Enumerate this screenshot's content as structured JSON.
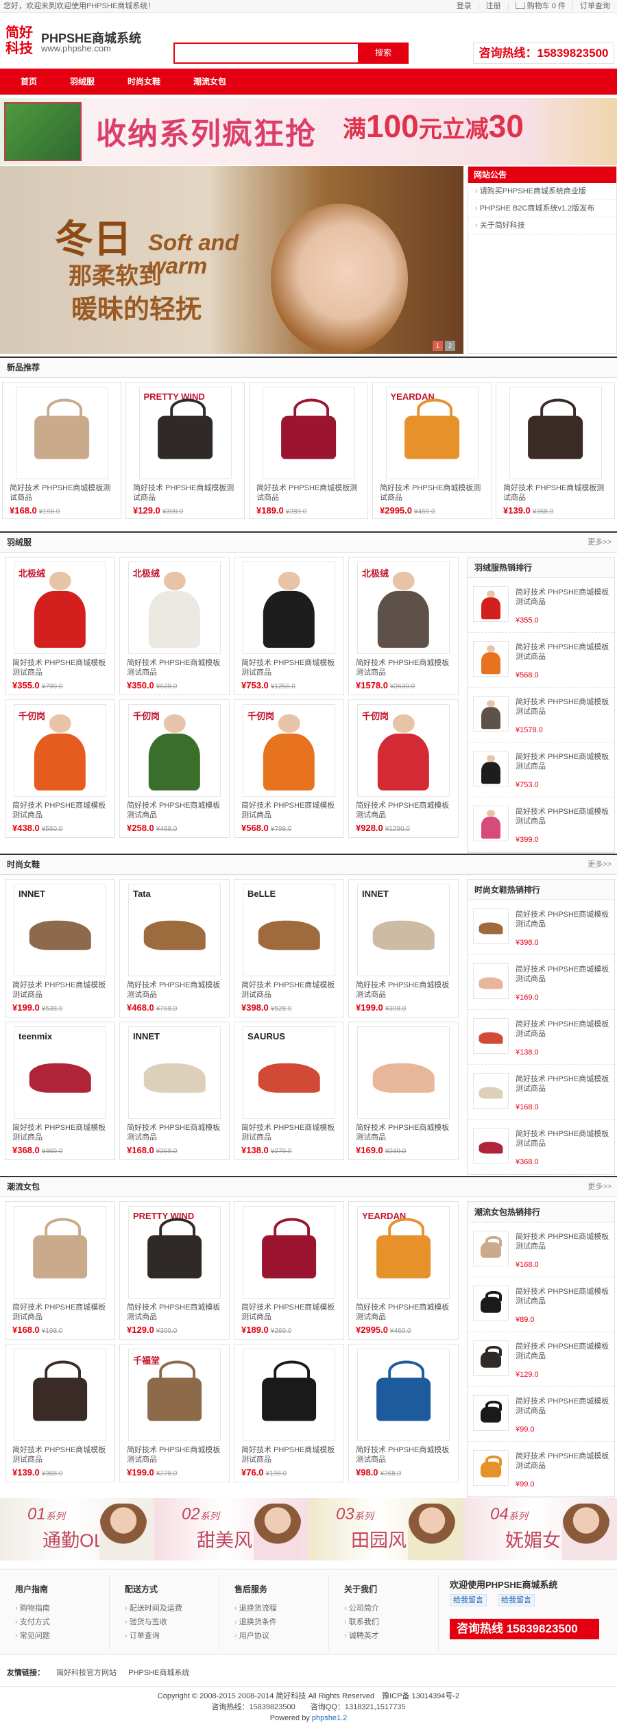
{
  "topbar": {
    "welcome": "您好，欢迎来到欢迎使用PHPSHE商城系统！",
    "login": "登录",
    "register": "注册",
    "cart": "购物车 0 件",
    "order_query": "订单查询"
  },
  "header": {
    "logo_text": "简好科技",
    "site_name": "PHPSHE商城系统",
    "site_url": "www.phpshe.com",
    "search_placeholder": "",
    "search_button": "搜索",
    "hotline": "咨询热线：15839823500"
  },
  "nav": [
    "首页",
    "羽绒服",
    "时尚女鞋",
    "潮流女包"
  ],
  "banner": {
    "text": "收纳系列疯狂抢",
    "deal_prefix": "满",
    "deal_amount": "100",
    "deal_mid": "元立减",
    "deal_off": "30"
  },
  "hero": {
    "line1": "冬日",
    "line2": "Soft and warm",
    "line3": "那柔软到",
    "line4": "暖昧的轻抚",
    "dot1": "1",
    "dot2": "2"
  },
  "notice": {
    "title": "网站公告",
    "items": [
      "请购买PHPSHE商城系统商业版",
      "PHPSHE B2C商城系统v1.2版发布",
      "关于简好科技"
    ]
  },
  "new_products": {
    "title": "新品推荐",
    "items": [
      {
        "name": "简好技术 PHPSHE商城模板测试商品",
        "price": "¥168.0",
        "old": "¥198.0",
        "color": "#c9ab8b"
      },
      {
        "name": "简好技术 PHPSHE商城模板测试商品",
        "price": "¥129.0",
        "old": "¥399.0",
        "color": "#2f2a27",
        "brand": "PRETTY WIND"
      },
      {
        "name": "简好技术 PHPSHE商城模板测试商品",
        "price": "¥189.0",
        "old": "¥289.0",
        "color": "#9b1530"
      },
      {
        "name": "简好技术 PHPSHE商城模板测试商品",
        "price": "¥2995.0",
        "old": "¥469.0",
        "color": "#e7912b",
        "brand": "YEARDAN"
      },
      {
        "name": "简好技术 PHPSHE商城模板测试商品",
        "price": "¥139.0",
        "old": "¥368.0",
        "color": "#3a2b26"
      }
    ]
  },
  "down": {
    "title": "羽绒服",
    "more": "更多>>",
    "items": [
      {
        "name": "简好技术 PHPSHE商城模板测试商品",
        "price": "¥355.0",
        "old": "¥799.0",
        "color": "#d41f1f",
        "brand": "北极绒"
      },
      {
        "name": "简好技术 PHPSHE商城模板测试商品",
        "price": "¥350.0",
        "old": "¥638.0",
        "color": "#ece9e2",
        "brand": "北极绒"
      },
      {
        "name": "简好技术 PHPSHE商城模板测试商品",
        "price": "¥753.0",
        "old": "¥1256.0",
        "color": "#1d1d1d"
      },
      {
        "name": "简好技术 PHPSHE商城模板测试商品",
        "price": "¥1578.0",
        "old": "¥2630.0",
        "color": "#5e5149",
        "brand": "北极绒"
      },
      {
        "name": "简好技术 PHPSHE商城模板测试商品",
        "price": "¥438.0",
        "old": "¥560.0",
        "color": "#e65c1e",
        "brand": "千仞岗"
      },
      {
        "name": "简好技术 PHPSHE商城模板测试商品",
        "price": "¥258.0",
        "old": "¥468.0",
        "color": "#3b6e2a",
        "brand": "千仞岗"
      },
      {
        "name": "简好技术 PHPSHE商城模板测试商品",
        "price": "¥568.0",
        "old": "¥798.0",
        "color": "#e8731f",
        "brand": "千仞岗"
      },
      {
        "name": "简好技术 PHPSHE商城模板测试商品",
        "price": "¥928.0",
        "old": "¥1290.0",
        "color": "#d42a33",
        "brand": "千仞岗"
      }
    ],
    "side_title": "羽绒服热销排行",
    "side_items": [
      {
        "name": "简好技术 PHPSHE商城模板测试商品",
        "price": "¥355.0",
        "color": "#d41f1f"
      },
      {
        "name": "简好技术 PHPSHE商城模板测试商品",
        "price": "¥568.0",
        "color": "#e8731f"
      },
      {
        "name": "简好技术 PHPSHE商城模板测试商品",
        "price": "¥1578.0",
        "color": "#5e5149"
      },
      {
        "name": "简好技术 PHPSHE商城模板测试商品",
        "price": "¥753.0",
        "color": "#1d1d1d"
      },
      {
        "name": "简好技术 PHPSHE商城模板测试商品",
        "price": "¥399.0",
        "color": "#d84a7a"
      }
    ]
  },
  "shoes": {
    "title": "时尚女鞋",
    "more": "更多>>",
    "items": [
      {
        "name": "简好技术 PHPSHE商城模板测试商品",
        "price": "¥199.0",
        "old": "¥538.0",
        "color": "#8d6a4c",
        "brand": "INNET"
      },
      {
        "name": "简好技术 PHPSHE商城模板测试商品",
        "price": "¥468.0",
        "old": "¥768.0",
        "color": "#9c6b3e",
        "brand": "Tata"
      },
      {
        "name": "简好技术 PHPSHE商城模板测试商品",
        "price": "¥398.0",
        "old": "¥528.0",
        "color": "#a06b3c",
        "brand": "BeLLE"
      },
      {
        "name": "简好技术 PHPSHE商城模板测试商品",
        "price": "¥199.0",
        "old": "¥308.0",
        "color": "#cdbba3",
        "brand": "INNET"
      },
      {
        "name": "简好技术 PHPSHE商城模板测试商品",
        "price": "¥368.0",
        "old": "¥469.0",
        "color": "#b0243a",
        "brand": "teenmix"
      },
      {
        "name": "简好技术 PHPSHE商城模板测试商品",
        "price": "¥168.0",
        "old": "¥268.0",
        "color": "#ddd0ba",
        "brand": "INNET"
      },
      {
        "name": "简好技术 PHPSHE商城模板测试商品",
        "price": "¥138.0",
        "old": "¥279.0",
        "color": "#d24a36",
        "brand": "SAURUS"
      },
      {
        "name": "简好技术 PHPSHE商城模板测试商品",
        "price": "¥169.0",
        "old": "¥249.0",
        "color": "#e8b79a"
      }
    ],
    "side_title": "时尚女鞋热销排行",
    "side_items": [
      {
        "name": "简好技术 PHPSHE商城模板测试商品",
        "price": "¥398.0",
        "color": "#a06b3c"
      },
      {
        "name": "简好技术 PHPSHE商城模板测试商品",
        "price": "¥169.0",
        "color": "#e8b79a"
      },
      {
        "name": "简好技术 PHPSHE商城模板测试商品",
        "price": "¥138.0",
        "color": "#d24a36"
      },
      {
        "name": "简好技术 PHPSHE商城模板测试商品",
        "price": "¥168.0",
        "color": "#ddd0ba"
      },
      {
        "name": "简好技术 PHPSHE商城模板测试商品",
        "price": "¥368.0",
        "color": "#b0243a"
      }
    ]
  },
  "bags": {
    "title": "潮流女包",
    "more": "更多>>",
    "items": [
      {
        "name": "简好技术 PHPSHE商城模板测试商品",
        "price": "¥168.0",
        "old": "¥198.0",
        "color": "#c9ab8b"
      },
      {
        "name": "简好技术 PHPSHE商城模板测试商品",
        "price": "¥129.0",
        "old": "¥399.0",
        "color": "#2f2a27",
        "brand": "PRETTY WIND"
      },
      {
        "name": "简好技术 PHPSHE商城模板测试商品",
        "price": "¥189.0",
        "old": "¥269.0",
        "color": "#9b1530"
      },
      {
        "name": "简好技术 PHPSHE商城模板测试商品",
        "price": "¥2995.0",
        "old": "¥469.0",
        "color": "#e7912b",
        "brand": "YEARDAN"
      },
      {
        "name": "简好技术 PHPSHE商城模板测试商品",
        "price": "¥139.0",
        "old": "¥368.0",
        "color": "#3a2b26"
      },
      {
        "name": "简好技术 PHPSHE商城模板测试商品",
        "price": "¥199.0",
        "old": "¥278.0",
        "color": "#8c6a4a",
        "brand": "千福堂"
      },
      {
        "name": "简好技术 PHPSHE商城模板测试商品",
        "price": "¥76.0",
        "old": "¥198.0",
        "color": "#1a1a1a"
      },
      {
        "name": "简好技术 PHPSHE商城模板测试商品",
        "price": "¥98.0",
        "old": "¥268.0",
        "color": "#1d5b9c"
      }
    ],
    "side_title": "潮流女包热销排行",
    "side_items": [
      {
        "name": "简好技术 PHPSHE商城模板测试商品",
        "price": "¥168.0",
        "color": "#c9ab8b"
      },
      {
        "name": "简好技术 PHPSHE商城模板测试商品",
        "price": "¥89.0",
        "color": "#1a1a1a"
      },
      {
        "name": "简好技术 PHPSHE商城模板测试商品",
        "price": "¥129.0",
        "color": "#2f2a27"
      },
      {
        "name": "简好技术 PHPSHE商城模板测试商品",
        "price": "¥99.0",
        "color": "#1a1a1a"
      },
      {
        "name": "简好技术 PHPSHE商城模板测试商品",
        "price": "¥99.0",
        "color": "#e7912b"
      }
    ]
  },
  "promo": [
    {
      "num": "01",
      "series": "系列",
      "title": "通勤OL",
      "bg": "#f1ece6"
    },
    {
      "num": "02",
      "series": "系列",
      "title": "甜美风",
      "bg": "#f6dde3"
    },
    {
      "num": "03",
      "series": "系列",
      "title": "田园风",
      "bg": "#efe8c9"
    },
    {
      "num": "04",
      "series": "系列",
      "title": "妩媚女人",
      "bg": "#f5e3e6"
    }
  ],
  "footer": {
    "cols": [
      {
        "title": "用户指南",
        "items": [
          "购物指南",
          "支付方式",
          "常见问题"
        ]
      },
      {
        "title": "配送方式",
        "items": [
          "配送时间及运费",
          "验货与签收",
          "订单查询"
        ]
      },
      {
        "title": "售后服务",
        "items": [
          "退换货流程",
          "退换货条件",
          "用户协议"
        ]
      },
      {
        "title": "关于我们",
        "items": [
          "公司简介",
          "联系我们",
          "诚聘英才"
        ]
      }
    ],
    "welcome": "欢迎使用PHPSHE商城系统",
    "qq1": "给我留言",
    "qq2": "给我留言",
    "phone": "咨询热线 15839823500"
  },
  "links": {
    "label": "友情链接：",
    "items": [
      "简好科技官方网站",
      "PHPSHE商城系统"
    ]
  },
  "copyright": {
    "line1": "Copyright © 2008-2015 2008-2014 简好科技 All Rights Reserved　豫ICP备 13014394号-2",
    "line2": "咨询热线：15839823500　　咨询QQ：1318321,1517735",
    "line3_prefix": "Powered by",
    "line3_link": "phpshe1.2"
  }
}
